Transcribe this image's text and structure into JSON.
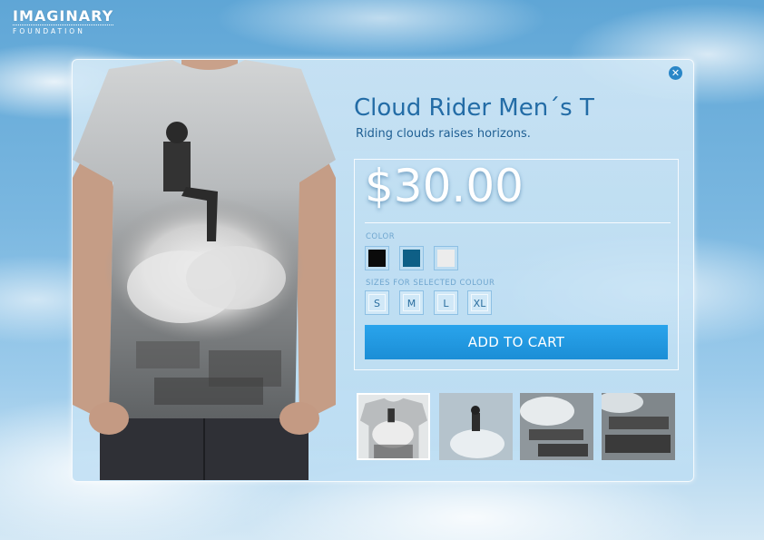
{
  "brand": {
    "name": "IMAGINARY",
    "sub": "FOUNDATION"
  },
  "product": {
    "title": "Cloud Rider Men´s T",
    "tagline": "Riding clouds raises horizons.",
    "price": "$30.00"
  },
  "color": {
    "label": "COLOR",
    "swatches": [
      {
        "name": "black",
        "hex": "#0b0b0b"
      },
      {
        "name": "blue",
        "hex": "#0e5f86"
      },
      {
        "name": "light-grey",
        "hex": "#ececec"
      }
    ]
  },
  "sizes": {
    "label": "SIZES FOR SELECTED COLOUR",
    "options": [
      "S",
      "M",
      "L",
      "XL"
    ]
  },
  "cart": {
    "label": "ADD TO CART"
  },
  "colors": {
    "accent": "#1f96de",
    "title": "#236ca6"
  },
  "icons": {
    "close": "close-icon"
  }
}
